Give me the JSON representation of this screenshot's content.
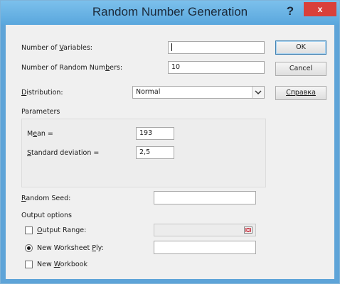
{
  "window": {
    "title": "Random Number Generation",
    "help_label": "?",
    "close_label": "x"
  },
  "fields": {
    "num_variables": {
      "label_pre": "Number of ",
      "label_u": "V",
      "label_post": "ariables:",
      "value": ""
    },
    "num_random": {
      "label_pre": "Number of Random Num",
      "label_u": "b",
      "label_post": "ers:",
      "value": "10"
    },
    "distribution": {
      "label_u": "D",
      "label_post": "istribution:",
      "value": "Normal"
    }
  },
  "parameters": {
    "title": "Parameters",
    "mean": {
      "label_pre": "M",
      "label_u": "e",
      "label_post": "an =",
      "value": "193"
    },
    "sd": {
      "label_u": "S",
      "label_post": "tandard deviation =",
      "value": "2,5"
    }
  },
  "seed": {
    "label_u": "R",
    "label_post": "andom Seed:",
    "value": ""
  },
  "output": {
    "title": "Output options",
    "range": {
      "label_u": "O",
      "label_post": "utput Range:",
      "value": "",
      "checked": false
    },
    "new_sheet": {
      "label_pre": "New Worksheet ",
      "label_u": "P",
      "label_post": "ly:",
      "value": "",
      "checked": true
    },
    "new_book": {
      "label_pre": "New ",
      "label_u": "W",
      "label_post": "orkbook",
      "checked": false
    }
  },
  "buttons": {
    "ok": "OK",
    "cancel": "Cancel",
    "help": "Справка"
  },
  "colors": {
    "titlebar": "#5ea4d8",
    "close": "#d9403a"
  }
}
